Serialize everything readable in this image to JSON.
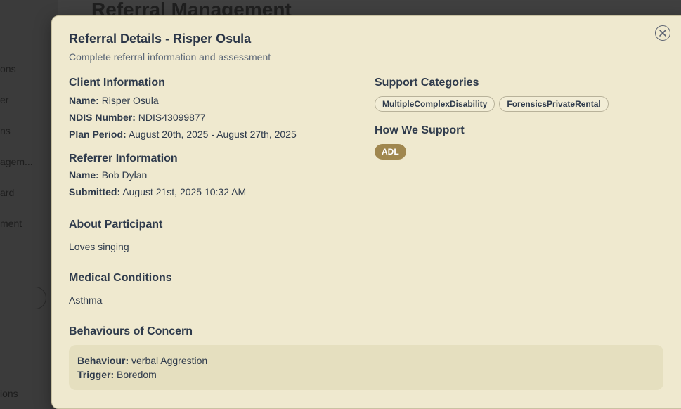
{
  "background": {
    "page_title": "Referral Management",
    "sidebar_items": [
      "ons",
      "er",
      "ns",
      "agem...",
      "ard",
      "ment",
      "ions"
    ]
  },
  "modal": {
    "title": "Referral Details - Risper Osula",
    "subtitle": "Complete referral information and assessment",
    "client": {
      "heading": "Client Information",
      "name_label": "Name:",
      "name": "Risper Osula",
      "ndis_label": "NDIS Number:",
      "ndis": "NDIS43099877",
      "plan_label": "Plan Period:",
      "plan": "August 20th, 2025 - August 27th, 2025"
    },
    "referrer": {
      "heading": "Referrer Information",
      "name_label": "Name:",
      "name": "Bob Dylan",
      "submitted_label": "Submitted:",
      "submitted": "August 21st, 2025 10:32 AM"
    },
    "support_categories": {
      "heading": "Support Categories",
      "tags": [
        "MultipleComplexDisability",
        "ForensicsPrivateRental"
      ]
    },
    "how_we_support": {
      "heading": "How We Support",
      "tags": [
        "ADL"
      ]
    },
    "about": {
      "heading": "About Participant",
      "text": "Loves singing"
    },
    "medical": {
      "heading": "Medical Conditions",
      "text": "Asthma"
    },
    "behaviours": {
      "heading": "Behaviours of Concern",
      "behaviour_label": "Behaviour:",
      "behaviour": "verbal Aggrestion",
      "trigger_label": "Trigger:",
      "trigger": "Boredom"
    }
  }
}
